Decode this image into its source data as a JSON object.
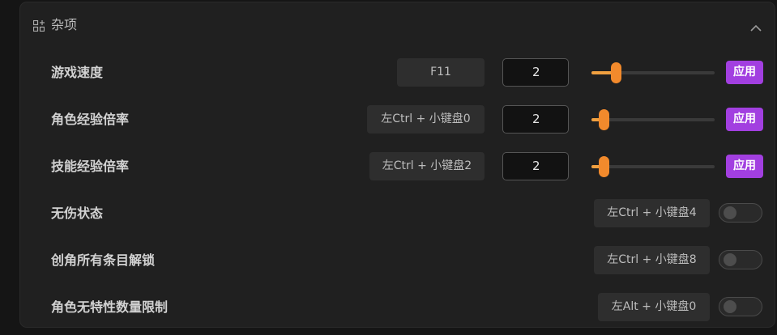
{
  "section": {
    "title": "杂项",
    "icon": "grid-plus-icon",
    "collapse_icon": "chevron-up-icon"
  },
  "colors": {
    "accent_apply": "#a23fe0",
    "slider_fill": "#f0a040",
    "slider_thumb": "#f28a2c",
    "panel_bg": "#202020"
  },
  "rows": [
    {
      "label": "游戏速度",
      "hotkey": "F11",
      "value": "2",
      "slider_fraction": 0.2,
      "apply": "应用",
      "type": "slider"
    },
    {
      "label": "角色经验倍率",
      "hotkey": "左Ctrl + 小键盘0",
      "value": "2",
      "slider_fraction": 0.1,
      "apply": "应用",
      "type": "slider"
    },
    {
      "label": "技能经验倍率",
      "hotkey": "左Ctrl + 小键盘2",
      "value": "2",
      "slider_fraction": 0.1,
      "apply": "应用",
      "type": "slider"
    },
    {
      "label": "无伤状态",
      "hotkey": "左Ctrl + 小键盘4",
      "enabled": false,
      "type": "toggle"
    },
    {
      "label": "创角所有条目解锁",
      "hotkey": "左Ctrl + 小键盘8",
      "enabled": false,
      "type": "toggle"
    },
    {
      "label": "角色无特性数量限制",
      "hotkey": "左Alt + 小键盘0",
      "enabled": false,
      "type": "toggle"
    }
  ]
}
